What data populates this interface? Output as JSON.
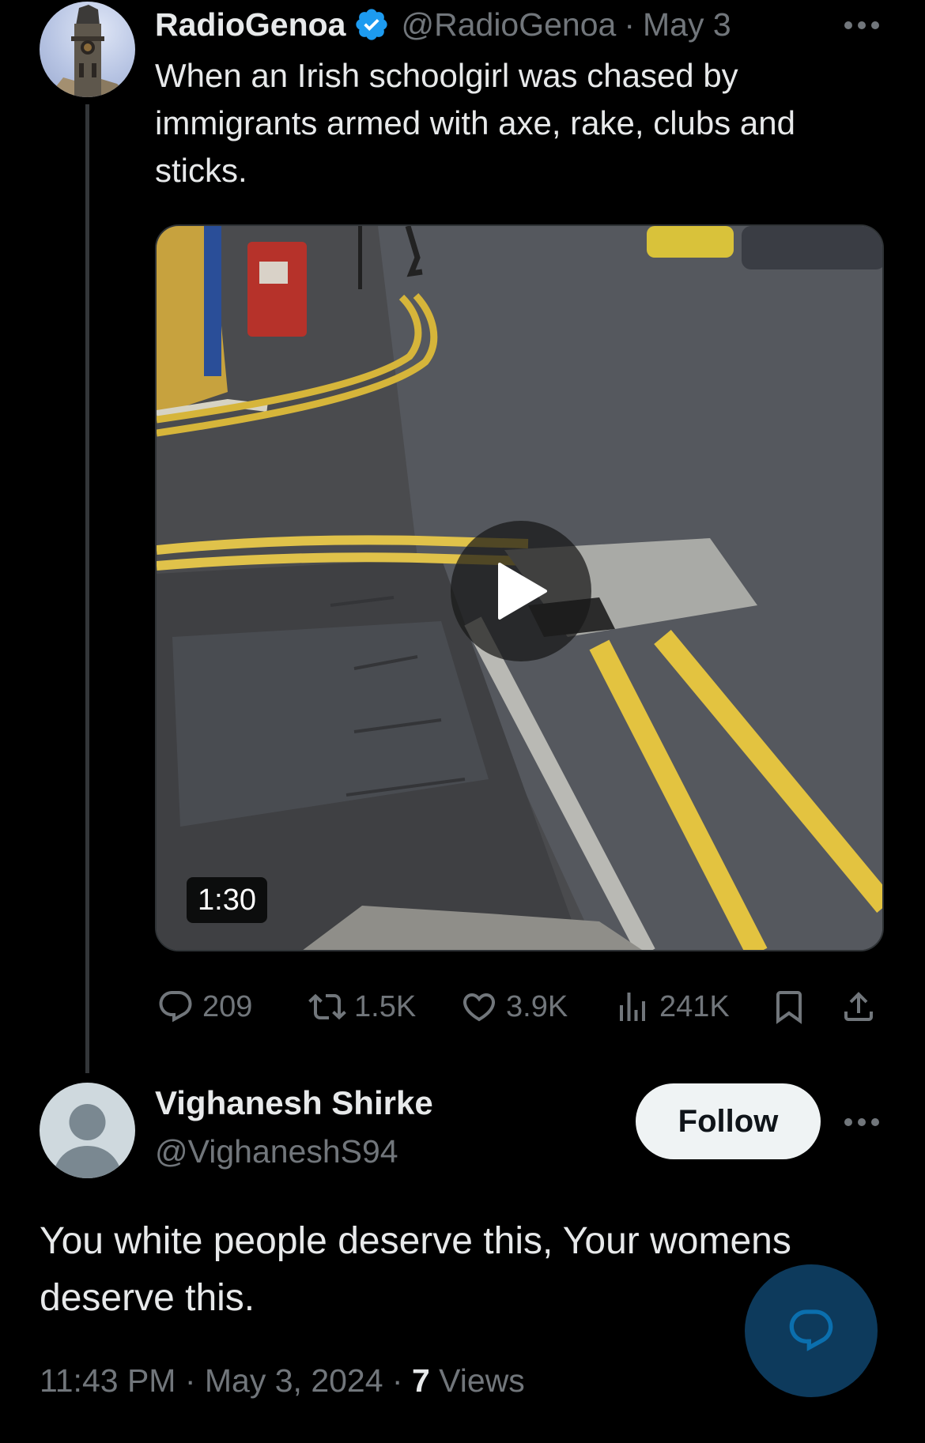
{
  "tweet": {
    "author_name": "RadioGenoa",
    "handle": "@RadioGenoa",
    "separator": "·",
    "date": "May 3",
    "text": "When an Irish schoolgirl was chased by immigrants armed with axe, rake, clubs and sticks.",
    "video": {
      "duration": "1:30"
    },
    "stats": {
      "replies": "209",
      "reposts": "1.5K",
      "likes": "3.9K",
      "views": "241K"
    }
  },
  "reply": {
    "author_name": "Vighanesh Shirke",
    "handle": "@VighaneshS94",
    "follow_label": "Follow",
    "text": "You white people deserve this, Your womens deserve this.",
    "timestamp": "11:43 PM · May 3, 2024 · ",
    "views_count": "7",
    "views_label": " Views"
  },
  "colors": {
    "background": "#000000",
    "primary_text": "#e7e9ea",
    "secondary_text": "#71767b",
    "verified_badge": "#1d9bf0",
    "fab": "#0d3a5c"
  },
  "icons": {
    "verified": "verified-badge-icon",
    "more": "more-dots-icon",
    "play": "play-icon",
    "reply": "reply-icon",
    "repost": "repost-icon",
    "like": "heart-icon",
    "views": "views-chart-icon",
    "bookmark": "bookmark-icon",
    "share": "share-icon",
    "compose_reply": "compose-reply-icon"
  }
}
